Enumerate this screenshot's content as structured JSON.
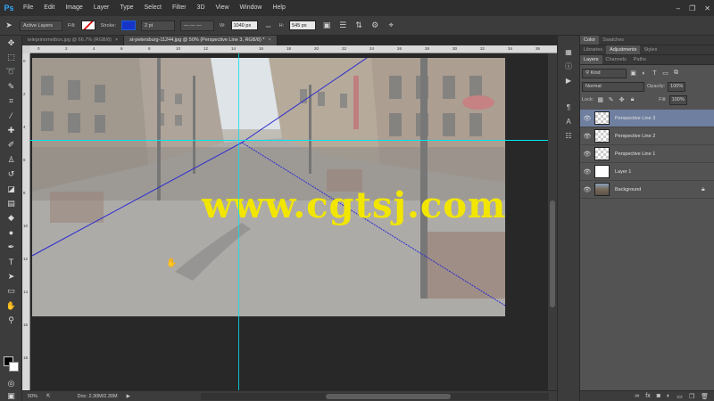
{
  "app": {
    "logo": "Ps"
  },
  "menu": [
    "File",
    "Edit",
    "Image",
    "Layer",
    "Type",
    "Select",
    "Filter",
    "3D",
    "View",
    "Window",
    "Help"
  ],
  "window_controls": [
    "–",
    "❐",
    "✕"
  ],
  "options": {
    "tool_mode": "Active Layers",
    "fill_label": "Fill:",
    "stroke_label": "Stroke:",
    "stroke_width": "2 pt",
    "w_label": "W:",
    "w_value": "1040 px",
    "h_label": "H:",
    "h_value": "545 px"
  },
  "tabs": [
    {
      "label": "teleprinometbox.jpg @ 66.7% (RGB/8)",
      "active": false,
      "close": "×"
    },
    {
      "label": "st-petersburg-11244.jpg @ 50% (Perspective Line 3, RGB/8) *",
      "active": true,
      "close": "×"
    }
  ],
  "ruler": {
    "top_ticks": [
      "0",
      "2",
      "4",
      "6",
      "8",
      "10",
      "12",
      "14",
      "16",
      "18",
      "20",
      "22",
      "24",
      "26",
      "28",
      "30",
      "32",
      "34",
      "36"
    ],
    "left_ticks": [
      "0",
      "2",
      "4",
      "6",
      "8",
      "10",
      "12",
      "14",
      "16",
      "18"
    ]
  },
  "watermark": "www.cgtsj.com",
  "status": {
    "zoom": "50%",
    "doc": "Doc: 2.30M/2.30M",
    "arrow": "▶"
  },
  "right_panels": {
    "top_tabs": [
      "Color",
      "Swatches"
    ],
    "mid_tabs": [
      "Libraries",
      "Adjustments",
      "Styles"
    ],
    "layer_tabs": [
      "Layers",
      "Channels",
      "Paths"
    ],
    "kind_filter": "Kind",
    "blend_mode": "Normal",
    "opacity_label": "Opacity:",
    "opacity_value": "100%",
    "lock_label": "Lock:",
    "fill_label": "Fill:",
    "fill_value": "100%"
  },
  "layers": [
    {
      "name": "Perspective Line 3",
      "thumb": "checker",
      "selected": true,
      "locked": false
    },
    {
      "name": "Perspective Line 2",
      "thumb": "checker",
      "selected": false,
      "locked": false
    },
    {
      "name": "Perspective Line 1",
      "thumb": "checker",
      "selected": false,
      "locked": false
    },
    {
      "name": "Layer 1",
      "thumb": "white",
      "selected": false,
      "locked": false
    },
    {
      "name": "Background",
      "thumb": "photo",
      "selected": false,
      "locked": true
    }
  ],
  "colors": {
    "accent_selection": "#6f7fa0",
    "guide": "#00e5ee",
    "perspective_line": "#2b2bd0",
    "watermark": "#f2e600"
  }
}
